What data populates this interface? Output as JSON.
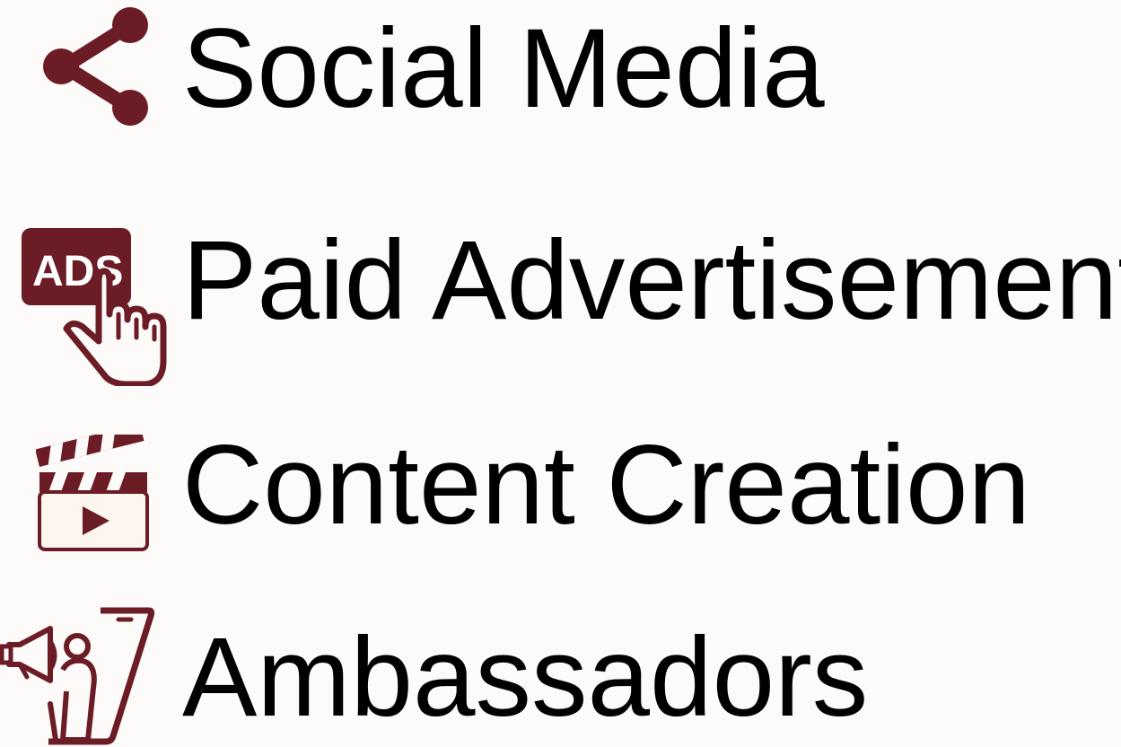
{
  "brand": {
    "accent_color": "#6b1c24",
    "background_color": "#fcfbfa"
  },
  "services": [
    {
      "label": "Social Media",
      "icon": "share-icon"
    },
    {
      "label": "Paid Advertisement",
      "icon": "ads-click-icon",
      "icon_text": "ADS"
    },
    {
      "label": "Content Creation",
      "icon": "clapperboard-play-icon"
    },
    {
      "label": "Ambassadors",
      "icon": "megaphone-phone-icon"
    }
  ]
}
